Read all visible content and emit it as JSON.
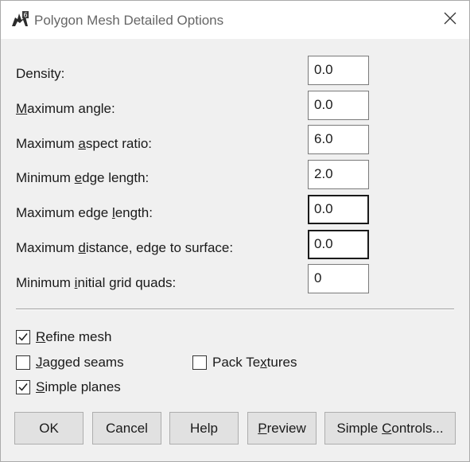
{
  "window": {
    "title": "Polygon Mesh Detailed Options",
    "app_icon": "rhino-icon",
    "close_icon": "close-icon"
  },
  "fields": [
    {
      "pre": "Density:",
      "key": "",
      "post": "",
      "value": "0.0"
    },
    {
      "pre": "",
      "key": "M",
      "post": "aximum angle:",
      "value": "0.0"
    },
    {
      "pre": "Maximum ",
      "key": "a",
      "post": "spect ratio:",
      "value": "6.0"
    },
    {
      "pre": "Minimum ",
      "key": "e",
      "post": "dge length:",
      "value": "2.0"
    },
    {
      "pre": "Maximum edge ",
      "key": "l",
      "post": "ength:",
      "value": "0.0"
    },
    {
      "pre": "Maximum ",
      "key": "d",
      "post": "istance, edge to surface:",
      "value": "0.0"
    },
    {
      "pre": "Minimum ",
      "key": "i",
      "post": "nitial grid quads:",
      "value": "0"
    }
  ],
  "checkboxes": {
    "refine_mesh": {
      "key": "R",
      "post": "efine mesh",
      "checked": true
    },
    "jagged_seams": {
      "key": "J",
      "post": "agged seams",
      "checked": false
    },
    "pack_textures": {
      "pre": "Pack Te",
      "key": "x",
      "post": "tures",
      "checked": false
    },
    "simple_planes": {
      "key": "S",
      "post": "imple planes",
      "checked": true
    }
  },
  "buttons": {
    "ok": {
      "label": "OK"
    },
    "cancel": {
      "label": "Cancel"
    },
    "help": {
      "label": "Help"
    },
    "preview": {
      "key": "P",
      "post": "review"
    },
    "simple_controls": {
      "pre": "Simple ",
      "key": "C",
      "post": "ontrols..."
    }
  },
  "colors": {
    "dialog_bg": "#f0f0f0",
    "titlebar_bg": "#ffffff",
    "button_bg": "#e1e1e1"
  }
}
